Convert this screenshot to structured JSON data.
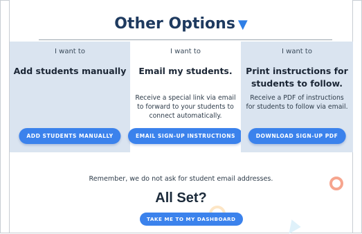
{
  "header": {
    "title": "Other Options",
    "toggle_icon": "caret-down-icon"
  },
  "options": [
    {
      "prefix": "I want to",
      "title": "Add students manually",
      "description": "",
      "button": "ADD STUDENTS MANUALLY"
    },
    {
      "prefix": "I want to",
      "title": "Email my students.",
      "description": "Receive a special link via email to forward to your students to connect automatically.",
      "button": "EMAIL SIGN-UP INSTRUCTIONS"
    },
    {
      "prefix": "I want to",
      "title": "Print instructions for students to follow.",
      "description": "Receive a PDF of instructions for students to follow via email.",
      "button": "DOWNLOAD SIGN-UP PDF"
    }
  ],
  "footer": {
    "note": "Remember, we do not ask for student email addresses.",
    "heading": "All Set?",
    "button": "TAKE ME TO MY DASHBOARD"
  },
  "colors": {
    "accent": "#3b82ec",
    "panel": "#dae4f0",
    "heading": "#1e3a5f"
  }
}
